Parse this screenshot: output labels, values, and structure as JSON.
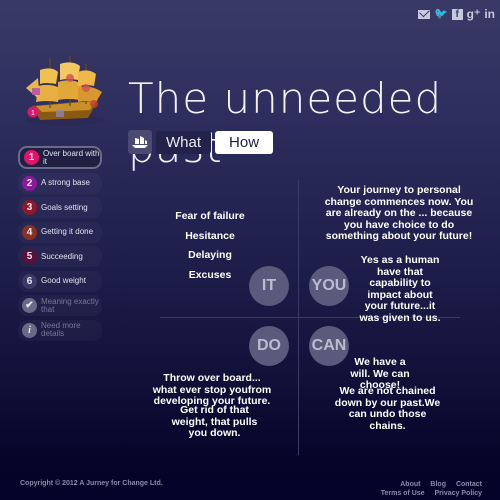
{
  "social": {
    "items": [
      {
        "icon": "mail-icon",
        "glyph": ""
      },
      {
        "icon": "twitter-icon",
        "glyph": "🐦"
      },
      {
        "icon": "facebook-icon",
        "glyph": "f"
      },
      {
        "icon": "google-plus-icon",
        "glyph": "g⁺"
      },
      {
        "icon": "linkedin-icon",
        "glyph": "in"
      }
    ]
  },
  "header": {
    "title": "The unneeded past"
  },
  "tabs": {
    "icon": "ship-icon",
    "what": "What",
    "how": "How",
    "active": "How"
  },
  "steps": [
    {
      "num": "1",
      "label": "Over board with it",
      "color": "#e0146a",
      "active": true
    },
    {
      "num": "2",
      "label": "A strong base",
      "color": "#8a1a9a"
    },
    {
      "num": "3",
      "label": "Goals setting",
      "color": "#8a1a2a"
    },
    {
      "num": "4",
      "label": "Getting it done",
      "color": "#8a3020"
    },
    {
      "num": "5",
      "label": "Succeeding",
      "color": "#5a1038"
    },
    {
      "num": "6",
      "label": "Good weight",
      "color": "#3a3a64"
    },
    {
      "num": "✔",
      "label": "Meaning exactly that",
      "color": "#6a6a88",
      "dim": true,
      "icon": "check-icon"
    },
    {
      "num": "i",
      "label": "Need more details",
      "color": "#6a6a88",
      "dim": true,
      "icon": "info-icon"
    }
  ],
  "quadrants": {
    "it": {
      "badge": "IT",
      "items": [
        "Fear of failure",
        "Hesitance",
        "Delaying",
        "Excuses"
      ]
    },
    "you": {
      "badge": "YOU",
      "text1": "Your journey to personal change commences now. You are already on the ... because you have choice to do something about your future!",
      "text2": "Yes as a human have that capability to impact about your future...it was given to us."
    },
    "do": {
      "badge": "DO",
      "text1": "Throw over board... what ever stop youfrom developing your future.",
      "text2": "Get rid of that weight, that pulls you down."
    },
    "can": {
      "badge": "CAN",
      "text1": "We have a will. We can choose!",
      "text2": "We are not chained down by our past.We can undo those chains."
    }
  },
  "footer": {
    "copyright": "Copyright © 2012 A Jurney for Change Ltd.",
    "links_row1": [
      "About",
      "Blog",
      "Contact"
    ],
    "links_row2": [
      "Terms of Use",
      "Privacy Policy"
    ]
  }
}
